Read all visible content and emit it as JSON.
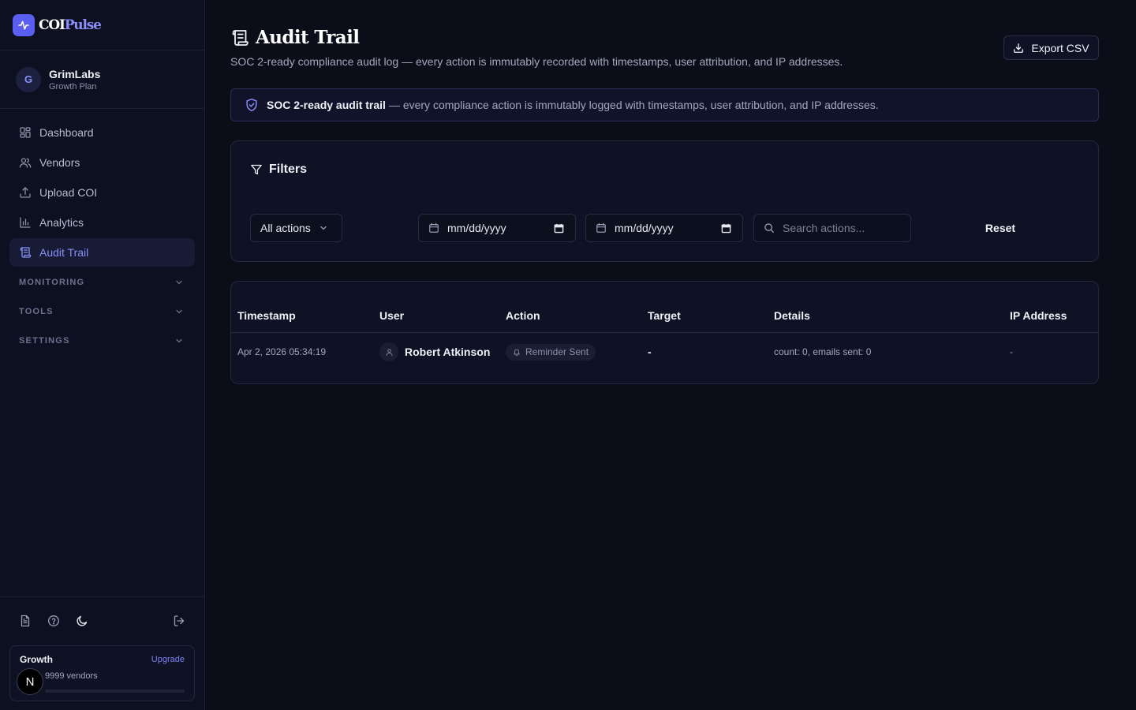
{
  "brand": {
    "name_part1": "COI",
    "name_part2": "Pulse"
  },
  "org": {
    "initial": "G",
    "name": "GrimLabs",
    "plan": "Growth Plan"
  },
  "nav": {
    "items": [
      {
        "label": "Dashboard",
        "icon": "dashboard-icon"
      },
      {
        "label": "Vendors",
        "icon": "users-icon"
      },
      {
        "label": "Upload COI",
        "icon": "upload-icon"
      },
      {
        "label": "Analytics",
        "icon": "bar-chart-icon"
      },
      {
        "label": "Audit Trail",
        "icon": "scroll-icon",
        "active": true
      }
    ],
    "groups": [
      {
        "label": "MONITORING"
      },
      {
        "label": "TOOLS"
      },
      {
        "label": "SETTINGS"
      }
    ]
  },
  "plan_card": {
    "name": "Growth",
    "upgrade": "Upgrade",
    "vendors": "9999 vendors",
    "usage_fraction": 0.0,
    "user_initial": "N"
  },
  "page": {
    "title": "Audit Trail",
    "subtitle": "SOC 2-ready compliance audit log — every action is immutably recorded with timestamps, user attribution, and IP addresses.",
    "export_label": "Export CSV"
  },
  "banner": {
    "strong": "SOC 2-ready audit trail",
    "rest": "— every compliance action is immutably logged with timestamps, user attribution, and IP addresses."
  },
  "filters": {
    "title": "Filters",
    "action_select": "All actions",
    "date_from": "mm/dd/yyyy",
    "date_to": "mm/dd/yyyy",
    "search_placeholder": "Search actions...",
    "reset": "Reset"
  },
  "table": {
    "columns": [
      "Timestamp",
      "User",
      "Action",
      "Target",
      "Details",
      "IP Address"
    ],
    "rows": [
      {
        "timestamp": "Apr 2, 2026 05:34:19",
        "user": "Robert Atkinson",
        "action": "Reminder Sent",
        "target": "-",
        "details": "count: 0, emails sent: 0",
        "ip": "-"
      }
    ]
  },
  "colors": {
    "accent": "#5a5ff2",
    "accent_text": "#8a8ff8",
    "background": "#0b0d18"
  }
}
